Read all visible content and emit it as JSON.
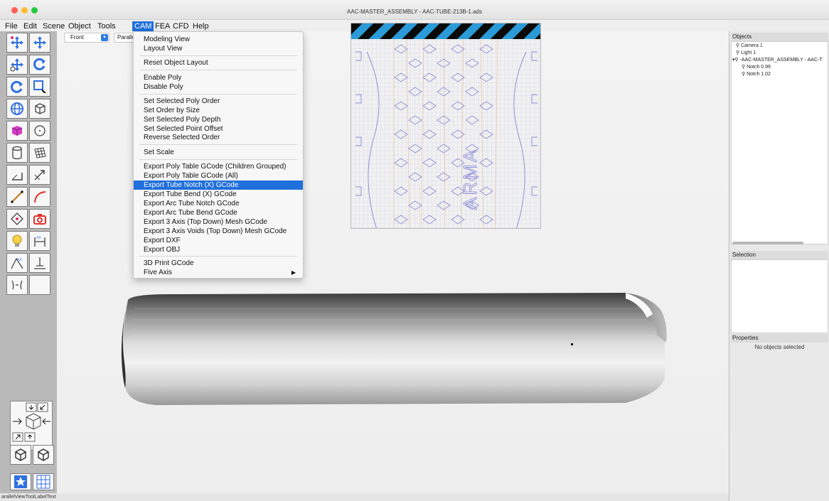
{
  "window": {
    "title": "AAC-MASTER_ASSEMBLY - AAC-TUBE-213B-1.ads"
  },
  "menubar": {
    "items": [
      "File",
      "Edit",
      "Scene",
      "Object",
      "Tools",
      "CAM",
      "FEA",
      "CFD",
      "Help"
    ],
    "active": "CAM"
  },
  "viewbar": {
    "view_select_value": "Front",
    "projection_select_value": "Paralle"
  },
  "cam_menu": {
    "items": [
      "Modeling View",
      "Layout View",
      "Reset Object Layout",
      "Enable Poly",
      "Disable Poly",
      "Set Selected Poly Order",
      "Set Order by Size",
      "Set Selected Poly Depth",
      "Set Selected Point Offset",
      "Reverse Selected Order",
      "Set Scale",
      "Export Poly Table GCode (Children Grouped)",
      "Export Poly Table GCode (All)",
      "Export Tube Notch (X) GCode",
      "Export Tube Bend (X) GCode",
      "Export Arc Tube Notch GCode",
      "Export Arc Tube Bend GCode",
      "Export 3 Axis (Top Down) Mesh GCode",
      "Export 3 Axis Voids (Top Down) Mesh GCode",
      "Export DXF",
      "Export OBJ",
      "3D Print GCode",
      "Five Axis"
    ],
    "highlighted": "Export Tube Notch (X) GCode",
    "submenu_item": "Five Axis"
  },
  "preview": {
    "watermark_text": "ARMA"
  },
  "objects_panel": {
    "title": "Objects",
    "tree": [
      "Camera 1",
      "Light 1",
      "-AAC-MASTER_ASSEMBLY - AAC-T",
      "Notch 0.99",
      "Notch 1.02"
    ]
  },
  "selection_panel": {
    "title": "Selection"
  },
  "properties_panel": {
    "title": "Properties",
    "empty_message": "No objects selected"
  },
  "status": {
    "text": "arallelViewToolLabelText"
  },
  "colors": {
    "menu_highlight": "#1f6fdc",
    "hazard_stripe_dark": "#0a0a0a",
    "hazard_stripe_light": "#2a9bd8",
    "pattern_line": "#8d8fd6",
    "pattern_grid": "#d99a5b"
  },
  "icons": {
    "tool_palette": [
      "move-icon",
      "move-axis-icon",
      "move-xyz-icon",
      "rotate-icon",
      "rotate-view-icon",
      "select-rect-icon",
      "globe-icon",
      "cube-icon",
      "magenta-cube-icon",
      "sphere-icon",
      "cylinder-icon",
      "grid-mesh-icon",
      "corner-icon",
      "arrow-expand-icon",
      "line-icon",
      "arc-icon",
      "point-icon",
      "camera-icon",
      "bulb-icon",
      "dimension-icon",
      "angle-icon",
      "text-icon",
      "spline-icon",
      "empty-tool"
    ]
  }
}
